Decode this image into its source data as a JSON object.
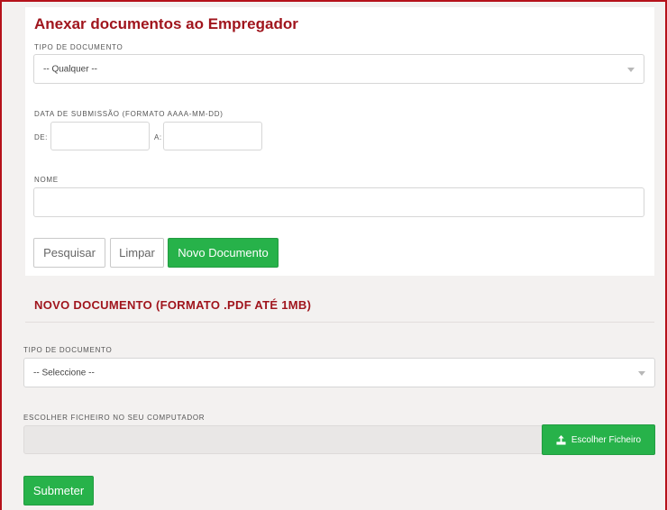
{
  "search_panel": {
    "title": "Anexar documentos ao Empregador",
    "doc_type_label": "TIPO DE DOCUMENTO",
    "doc_type_value": "-- Qualquer --",
    "date_label": "DATA DE SUBMISSÃO (FORMATO AAAA-MM-DD)",
    "from_label": "DE:",
    "from_value": "",
    "to_label": "A:",
    "to_value": "",
    "name_label": "NOME",
    "name_value": "",
    "buttons": {
      "search": "Pesquisar",
      "clear": "Limpar",
      "new_document": "Novo Documento"
    }
  },
  "new_document": {
    "title": "NOVO DOCUMENTO (FORMATO .PDF ATÉ 1MB)",
    "doc_type_label": "TIPO DE DOCUMENTO",
    "doc_type_value": "-- Seleccione --",
    "file_label": "ESCOLHER FICHEIRO NO SEU COMPUTADOR",
    "file_value": "",
    "choose_file_button": "Escolher Ficheiro",
    "choose_file_icon": "upload-icon",
    "submit_button": "Submeter"
  },
  "colors": {
    "accent_red": "#a0151d",
    "frame_red": "#b5121b",
    "primary_green": "#27b24a",
    "background": "#f3f1f0"
  }
}
